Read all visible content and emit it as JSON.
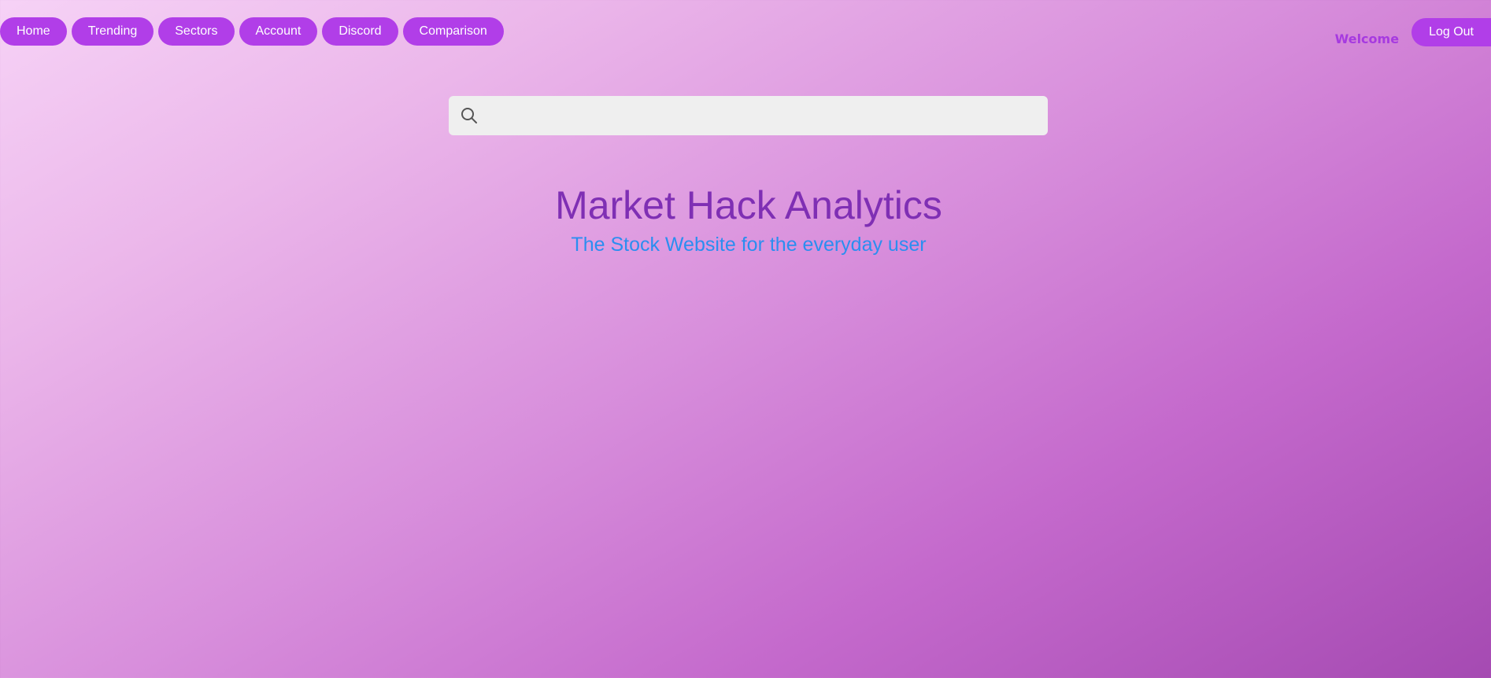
{
  "nav": {
    "items": [
      {
        "label": "Home"
      },
      {
        "label": "Trending"
      },
      {
        "label": "Sectors"
      },
      {
        "label": "Account"
      },
      {
        "label": "Discord"
      },
      {
        "label": "Comparison"
      }
    ]
  },
  "user": {
    "welcome_text": "Welcome",
    "logout_label": "Log Out"
  },
  "search": {
    "placeholder": "",
    "value": "",
    "icon": "search-icon"
  },
  "hero": {
    "title": "Market Hack Analytics",
    "subtitle": "The Stock Website for the everyday user"
  },
  "colors": {
    "button_bg": "#b13ee8",
    "button_text": "#ffffff",
    "welcome_text": "#a63ae0",
    "title": "#7f2fb4",
    "subtitle": "#2b8ef0",
    "search_bg": "#efefef"
  }
}
